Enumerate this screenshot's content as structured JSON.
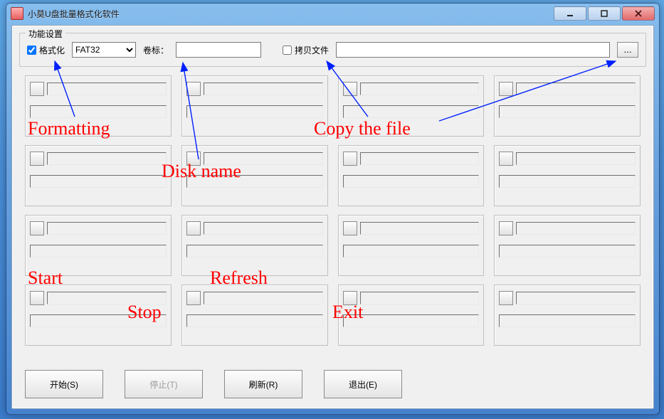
{
  "window": {
    "title": "小莫U盘批量格式化软件"
  },
  "settings": {
    "legend": "功能设置",
    "format_label": "格式化",
    "format_checked": true,
    "filesystem": "FAT32",
    "volume_label": "卷标：",
    "volume_value": "",
    "copy_label": "拷贝文件",
    "copy_checked": false,
    "path_value": "",
    "browse_label": "..."
  },
  "buttons": {
    "start": "开始(S)",
    "stop": "停止(T)",
    "refresh": "刷新(R)",
    "exit": "退出(E)"
  },
  "annotations": {
    "formatting": "Formatting",
    "diskname": "Disk name",
    "copyfile": "Copy the file",
    "start": "Start",
    "stop": "Stop",
    "refresh": "Refresh",
    "exit": "Exit"
  }
}
